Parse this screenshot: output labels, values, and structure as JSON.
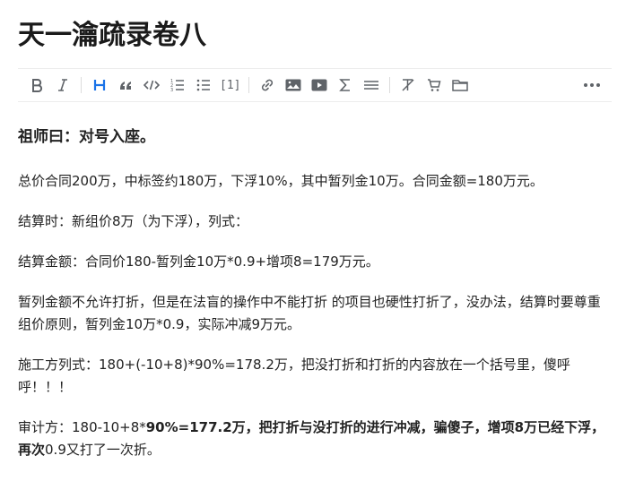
{
  "document": {
    "title": "天一瀹疏录卷八"
  },
  "toolbar": {
    "items": [
      {
        "name": "bold-button",
        "icon": "bold-icon"
      },
      {
        "name": "italic-button",
        "icon": "italic-icon"
      },
      {
        "name": "heading-button",
        "icon": "heading-icon"
      },
      {
        "name": "quote-button",
        "icon": "quote-icon"
      },
      {
        "name": "code-button",
        "icon": "code-icon"
      },
      {
        "name": "ordered-list-button",
        "icon": "ordered-list-icon"
      },
      {
        "name": "bullet-list-button",
        "icon": "bullet-list-icon"
      },
      {
        "name": "footnote-button",
        "label": "[1]"
      },
      {
        "name": "link-button",
        "icon": "link-icon"
      },
      {
        "name": "image-button",
        "icon": "image-icon"
      },
      {
        "name": "video-button",
        "icon": "video-icon"
      },
      {
        "name": "formula-button",
        "icon": "sigma-icon"
      },
      {
        "name": "divider-button",
        "icon": "horizontal-rule-icon"
      },
      {
        "name": "clear-format-button",
        "icon": "clear-format-icon"
      },
      {
        "name": "cart-button",
        "icon": "cart-icon"
      },
      {
        "name": "folder-button",
        "icon": "folder-icon"
      },
      {
        "name": "more-button",
        "icon": "more-icon"
      }
    ],
    "footnote_label": "[1]",
    "accent_color": "#1a73e8",
    "icon_color": "#5f6368"
  },
  "content": {
    "heading": "祖师曰：对号入座。",
    "p1": "总价合同200万，中标签约180万，下浮10%，其中暂列金10万。合同金额=180万元。",
    "p2": "结算时：新组价8万（为下浮），列式：",
    "p3": "结算金额：合同价180-暂列金10万*0.9+增项8=179万元。",
    "p4": "暂列金额不允许打折，但是在法盲的操作中不能打折 的项目也硬性打折了，没办法，结算时要尊重组价原则，暂列金10万*0.9，实际冲减9万元。",
    "p5": "施工方列式：180+(-10+8)*90%=178.2万，把没打折和打折的内容放在一个括号里，傻呼呼！！！",
    "p6_plain1": "审计方：180-10+8*",
    "p6_bold1": "90%=177.2万，把打折与没打折的进行冲减，骗傻子，增项8万已经下浮，再次",
    "p6_plain2": "0.9又打了一次折。"
  }
}
